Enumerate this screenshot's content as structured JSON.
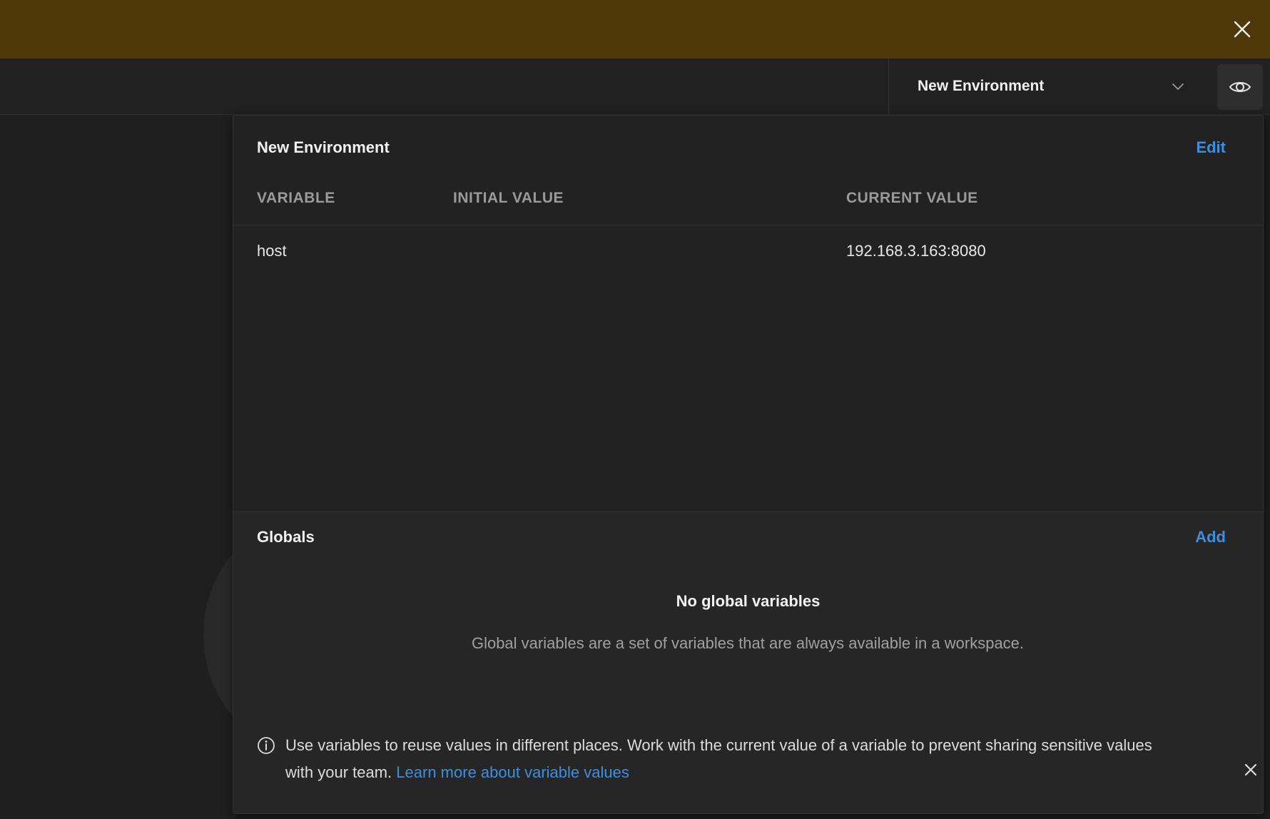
{
  "colors": {
    "banner": "#4f390b",
    "accent": "#3d8fe0",
    "panel": "#242424"
  },
  "banner": {
    "close_icon": "close-icon"
  },
  "toolbar": {
    "environment_selector": "New Environment",
    "chevron_icon": "chevron-down-icon",
    "eye_icon": "eye-icon"
  },
  "environment": {
    "title": "New Environment",
    "edit_label": "Edit",
    "columns": [
      "VARIABLE",
      "INITIAL VALUE",
      "CURRENT VALUE"
    ],
    "rows": [
      {
        "variable": "host",
        "initial_value": "",
        "current_value": "192.168.3.163:8080"
      }
    ]
  },
  "globals": {
    "title": "Globals",
    "add_label": "Add",
    "empty_title": "No global variables",
    "empty_description": "Global variables are a set of variables that are always available in a workspace."
  },
  "info": {
    "icon": "info-icon",
    "text": "Use variables to reuse values in different places. Work with the current value of a variable to prevent sharing sensitive values with your team.",
    "link": "Learn more about variable values",
    "close_icon": "close-icon"
  }
}
